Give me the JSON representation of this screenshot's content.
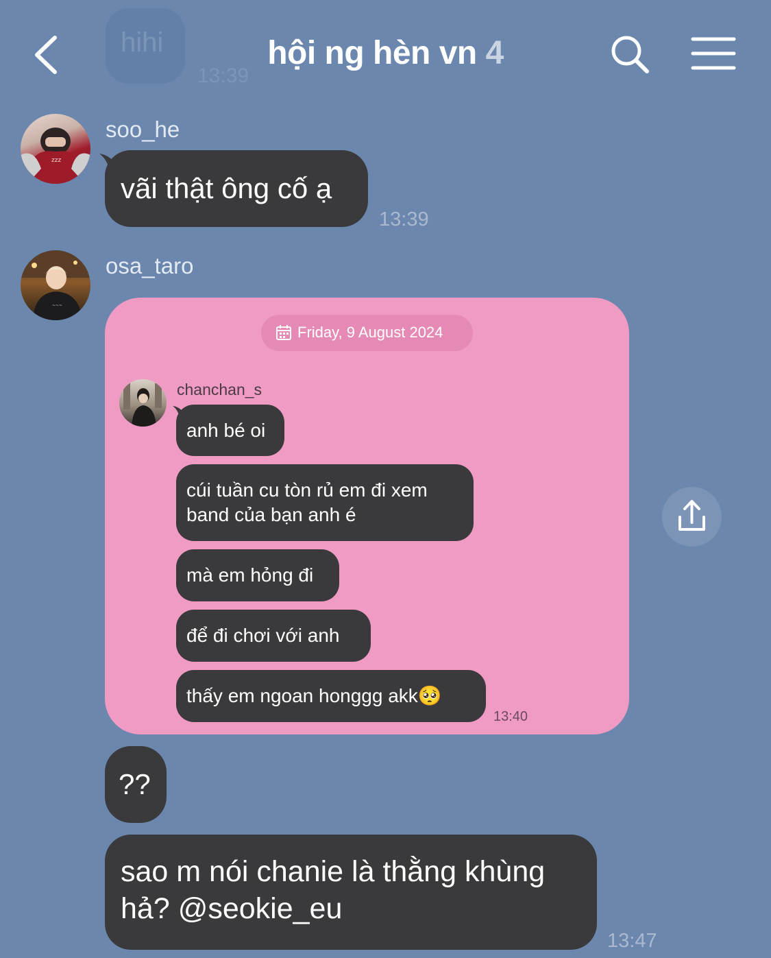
{
  "header": {
    "title": "hội ng hèn vn",
    "member_count": "4",
    "back_icon": "chevron-left-icon",
    "search_icon": "search-icon",
    "menu_icon": "hamburger-menu-icon"
  },
  "faded_previous": {
    "text": "hihi",
    "time": "13:39"
  },
  "messages": [
    {
      "sender": "soo_he",
      "text": "vãi thật ông cố ạ",
      "time": "13:39"
    },
    {
      "sender": "osa_taro",
      "shared_chat": {
        "date": "Friday, 9 August 2024",
        "sender": "chanchan_s",
        "lines": [
          "anh bé oi",
          "cúi tuần cu tòn rủ em đi xem band của bạn anh é",
          "mà em hỏng đi",
          "để đi chơi với anh",
          "thấy em ngoan honggg akk🥺"
        ],
        "time": "13:40"
      },
      "followups": [
        {
          "text": "??"
        },
        {
          "text": "sao m nói chanie là thằng khùng hả? @seokie_eu",
          "time": "13:47"
        }
      ]
    }
  ],
  "colors": {
    "background": "#6b87ad",
    "bubble": "#3a3a3c",
    "shared_card": "#ef9bc3"
  }
}
